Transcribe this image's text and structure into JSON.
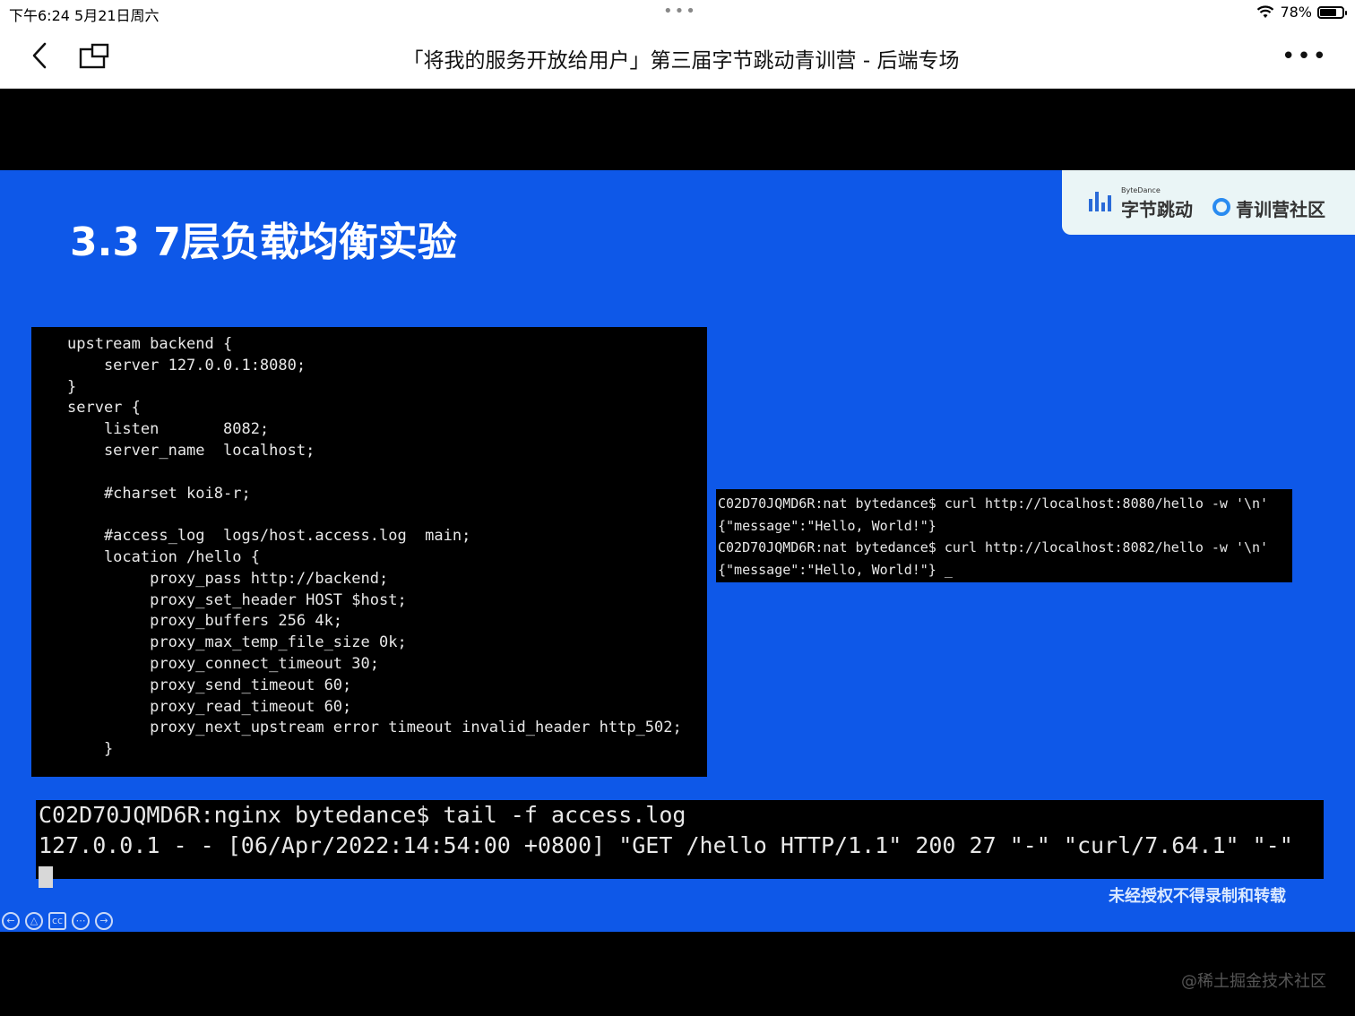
{
  "status_bar": {
    "time_date": "下午6:24   5月21日周六",
    "dots": "•••",
    "battery_text": "78%"
  },
  "nav": {
    "title": "「将我的服务开放给用户」第三届字节跳动青训营 - 后端专场",
    "more": "•••"
  },
  "slide": {
    "title": "3.3 7层负载均衡实验",
    "brand": {
      "small": "ByteDance",
      "name": "字节跳动",
      "community": "青训营社区"
    },
    "nginx_config": [
      "upstream backend {",
      "    server 127.0.0.1:8080;",
      "}",
      "server {",
      "    listen       8082;",
      "    server_name  localhost;",
      "",
      "    #charset koi8-r;",
      "",
      "    #access_log  logs/host.access.log  main;",
      "    location /hello {",
      "         proxy_pass http://backend;",
      "         proxy_set_header HOST $host;",
      "         proxy_buffers 256 4k;",
      "         proxy_max_temp_file_size 0k;",
      "         proxy_connect_timeout 30;",
      "         proxy_send_timeout 60;",
      "         proxy_read_timeout 60;",
      "         proxy_next_upstream error timeout invalid_header http_502;",
      "    }"
    ],
    "curl_terminal": [
      "C02D70JQMD6R:nat bytedance$ curl http://localhost:8080/hello -w '\\n'",
      "{\"message\":\"Hello, World!\"}",
      "C02D70JQMD6R:nat bytedance$ curl http://localhost:8082/hello -w '\\n'",
      "{\"message\":\"Hello, World!\"} _"
    ],
    "tail_terminal": [
      "C02D70JQMD6R:nginx bytedance$ tail -f access.log",
      "127.0.0.1 - - [06/Apr/2022:14:54:00 +0800] \"GET /hello HTTP/1.1\" 200 27 \"-\" \"curl/7.64.1\" \"-\""
    ],
    "notice": "未经授权不得录制和转载"
  },
  "player_controls": [
    "prev-icon",
    "pointer-icon",
    "cc-icon",
    "more-icon",
    "next-icon"
  ],
  "site_watermark": "@稀土掘金技术社区",
  "colors": {
    "slide_bg": "#0e58e8",
    "terminal_bg": "#000000",
    "brand_blue": "#2a6bd8"
  }
}
